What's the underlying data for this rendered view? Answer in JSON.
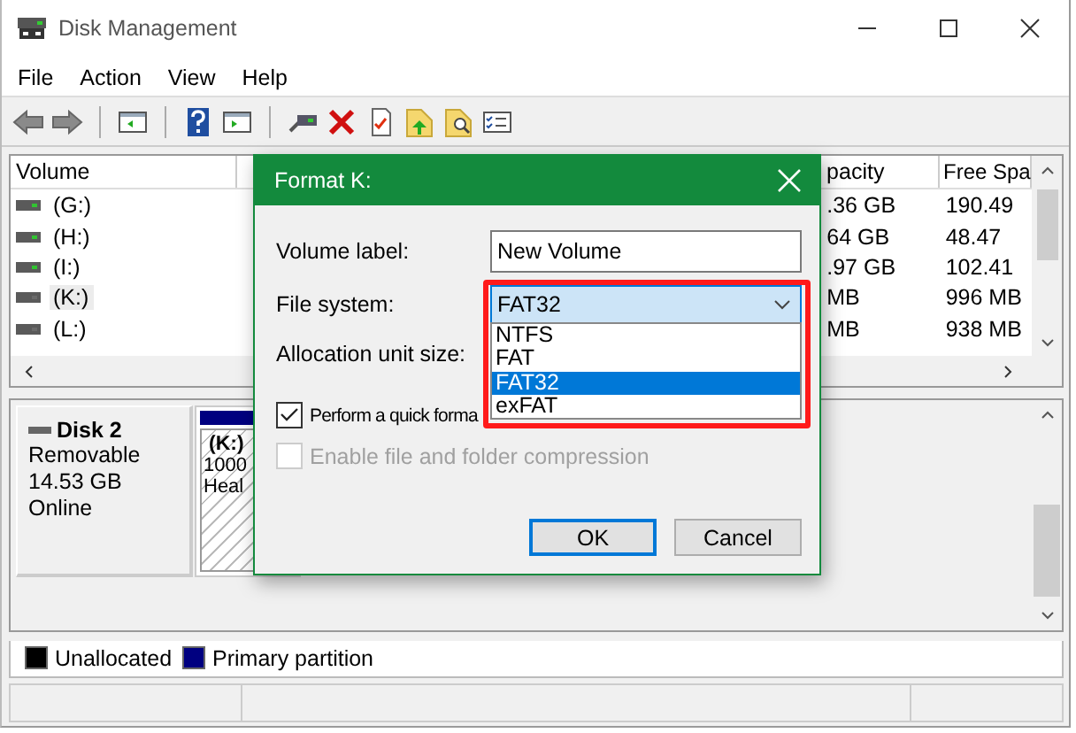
{
  "window": {
    "title": "Disk Management"
  },
  "menu": [
    "File",
    "Action",
    "View",
    "Help"
  ],
  "volume_table": {
    "columns": [
      "Volume",
      "pacity",
      "Free Spa"
    ],
    "rows": [
      {
        "cells": [
          "(G:)",
          ".36 GB",
          "190.49"
        ],
        "kind": "fixed",
        "selected": false
      },
      {
        "cells": [
          "(H:)",
          "64 GB",
          "48.47"
        ],
        "kind": "fixed",
        "selected": false
      },
      {
        "cells": [
          "(I:)",
          ".97 GB",
          "102.41"
        ],
        "kind": "fixed",
        "selected": false
      },
      {
        "cells": [
          "(K:)",
          "MB",
          "996 MB"
        ],
        "kind": "removable",
        "selected": true
      },
      {
        "cells": [
          "(L:)",
          "MB",
          "938 MB"
        ],
        "kind": "removable",
        "selected": false
      }
    ]
  },
  "disk": {
    "name": "Disk 2",
    "type": "Removable",
    "size": "14.53 GB",
    "status": "Online",
    "partition": {
      "label": "(K:)",
      "size": "1000",
      "status": "Heal"
    }
  },
  "legend": [
    {
      "label": "Unallocated",
      "color": "#000000"
    },
    {
      "label": "Primary partition",
      "color": "#000080"
    }
  ],
  "dialog": {
    "title": "Format K:",
    "volume_label": {
      "label": "Volume label:",
      "value": "New Volume"
    },
    "file_system": {
      "label": "File system:",
      "value": "FAT32",
      "expanded": true,
      "options": [
        {
          "label": "NTFS",
          "selected": false
        },
        {
          "label": "FAT",
          "selected": false
        },
        {
          "label": "FAT32",
          "selected": true
        },
        {
          "label": "exFAT",
          "selected": false
        }
      ]
    },
    "allocation": {
      "label": "Allocation unit size:"
    },
    "checkboxes": [
      {
        "label": "Perform a quick forma",
        "checked": true,
        "disabled": false
      },
      {
        "label": "Enable file and folder compression",
        "checked": false,
        "disabled": true
      }
    ],
    "buttons": [
      {
        "label": "OK",
        "default": true
      },
      {
        "label": "Cancel",
        "default": false
      }
    ]
  }
}
